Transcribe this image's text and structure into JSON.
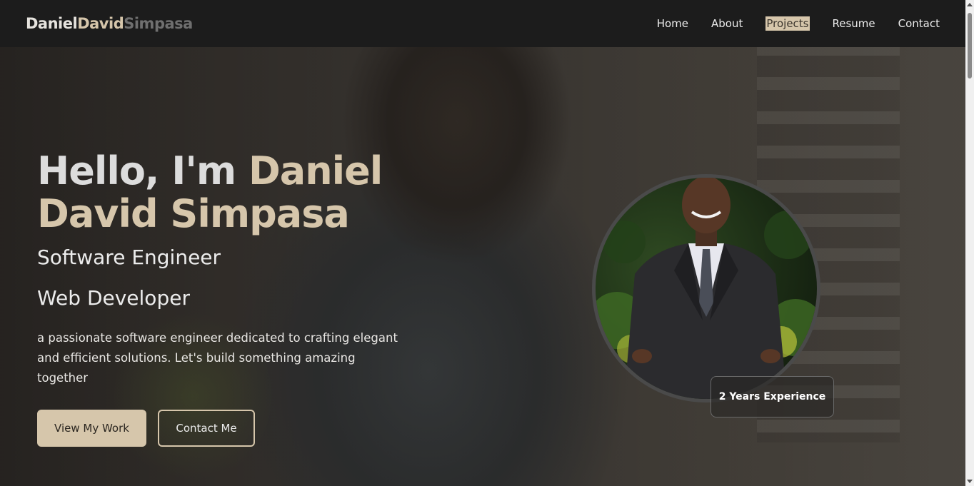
{
  "nav": {
    "logo": {
      "part1": "Daniel",
      "part2": "David",
      "part3": "Simpasa"
    },
    "links": [
      "Home",
      "About",
      "Projects",
      "Resume",
      "Contact"
    ],
    "active": "Projects"
  },
  "hero": {
    "greeting": "Hello, I'm ",
    "name": "Daniel David Simpasa",
    "role1": "Software Engineer",
    "role2": "Web Developer",
    "description": "a passionate software engineer dedicated to crafting elegant and efficient solutions. Let's build something amazing together",
    "primary_button": "View My Work",
    "secondary_button": "Contact Me"
  },
  "profile": {
    "experience_badge": "2 Years Experience"
  },
  "colors": {
    "accent": "#d6c6ab",
    "nav_bg": "#1c1c1c",
    "logo_muted": "#6f6f6f"
  }
}
